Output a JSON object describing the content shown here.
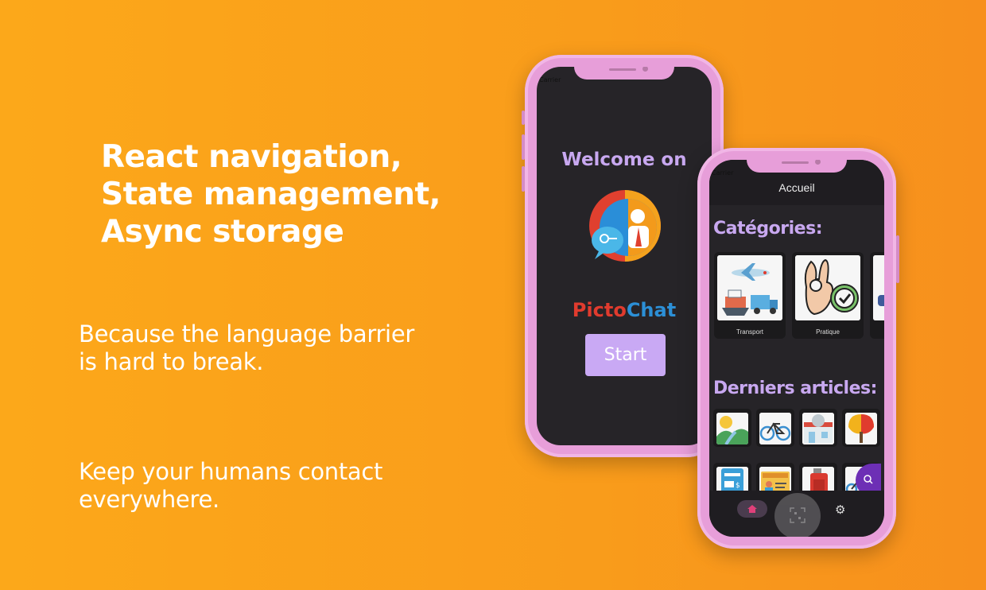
{
  "headline": {
    "line1": "React navigation,",
    "line2": "State management,",
    "line3": "Async storage"
  },
  "tagline1": {
    "line1": "Because the language barrier",
    "line2": "is hard to break."
  },
  "tagline2": {
    "line1": "Keep your humans contact",
    "line2": "everywhere."
  },
  "phone1": {
    "carrier": "Carrier",
    "welcome": "Welcome on",
    "brand_part1": "Picto",
    "brand_part2": "Chat",
    "start_label": "Start",
    "logo_icon": "pictochat-logo-icon"
  },
  "phone2": {
    "carrier": "Carrier",
    "nav_title": "Accueil",
    "categories_title": "Catégories:",
    "categories": [
      {
        "label": "Transport",
        "icon": "transport-icon"
      },
      {
        "label": "Pratique",
        "icon": "ok-hand-icon"
      }
    ],
    "articles_title": "Derniers articles:",
    "articles": [
      {
        "icon": "landscape-icon"
      },
      {
        "icon": "bicycle-icon"
      },
      {
        "icon": "restaurant-icon"
      },
      {
        "icon": "tree-icon"
      },
      {
        "icon": "ticket-icon"
      },
      {
        "icon": "id-card-icon"
      },
      {
        "icon": "fuel-can-icon"
      },
      {
        "icon": "scooter-icon"
      }
    ],
    "tabs": [
      {
        "icon": "home-icon"
      },
      {
        "icon": "scan-icon"
      },
      {
        "icon": "gear-icon"
      }
    ],
    "fab_icon": "search-icon"
  },
  "colors": {
    "background": "#fca81a",
    "phone_frame": "#e79ed9",
    "screen_bg": "#262428",
    "accent_purple": "#c8a8f0",
    "brand_red": "#e03b2e",
    "brand_blue": "#2c8fd6",
    "fab": "#6d2fb5"
  }
}
